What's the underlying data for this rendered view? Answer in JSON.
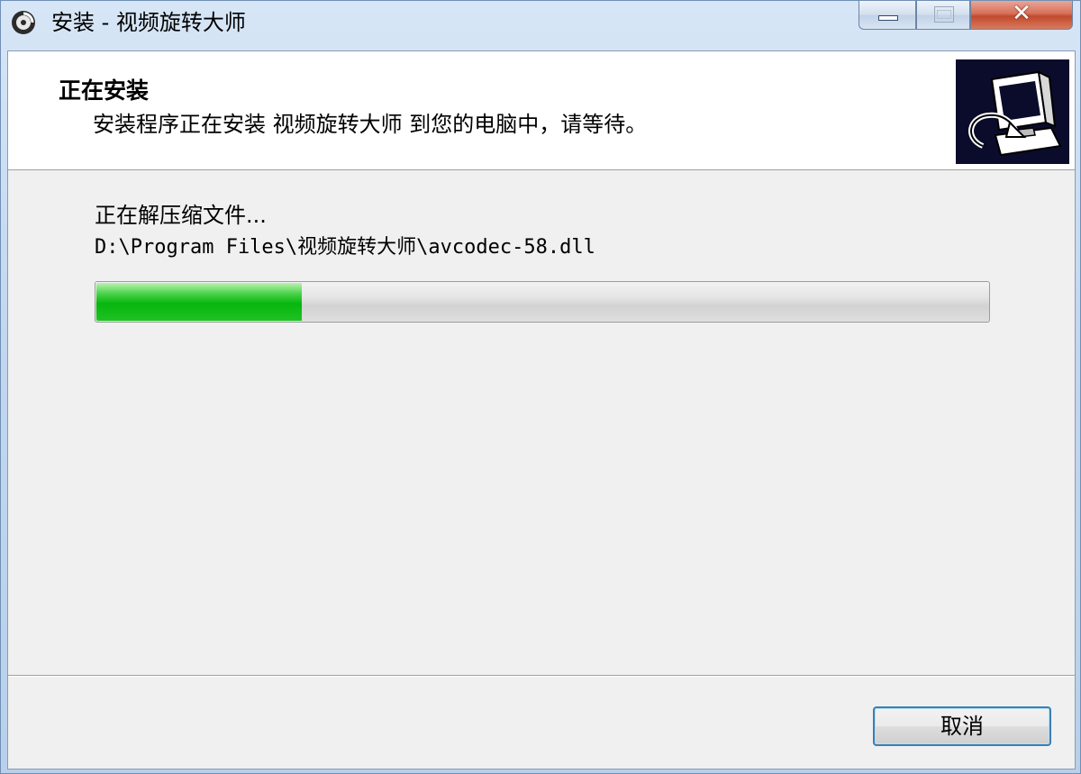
{
  "window": {
    "title": "安装 - 视频旋转大师",
    "close_glyph": "✕"
  },
  "header": {
    "title": "正在安装",
    "subtitle": "安装程序正在安装 视频旋转大师 到您的电脑中，请等待。",
    "image_icon": "computer-install-icon"
  },
  "main": {
    "status": "正在解压缩文件...",
    "current_file": "D:\\Program Files\\视频旋转大师\\avcodec-58.dll",
    "progress_fraction": 0.23,
    "progress_color": "#07b60e"
  },
  "buttons": {
    "cancel_label": "取消"
  },
  "colors": {
    "titlebar_bg": "#c3d8ef",
    "client_bg": "#f0f0f0",
    "header_bg": "#ffffff",
    "close_button": "#c14a2e"
  }
}
